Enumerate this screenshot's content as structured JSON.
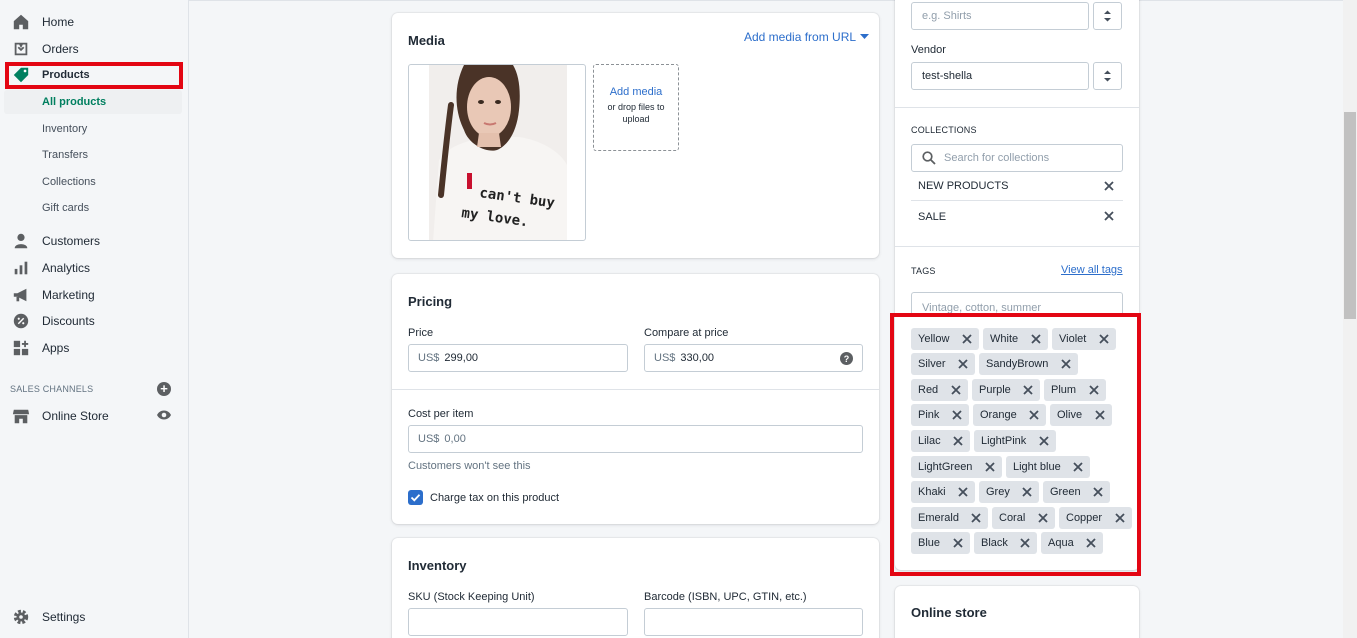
{
  "sidebar": {
    "items": [
      {
        "label": "Home",
        "icon": "home-icon"
      },
      {
        "label": "Orders",
        "icon": "orders-icon"
      },
      {
        "label": "Products",
        "icon": "tag-icon"
      },
      {
        "label": "Customers",
        "icon": "person-icon"
      },
      {
        "label": "Analytics",
        "icon": "bar-chart-icon"
      },
      {
        "label": "Marketing",
        "icon": "megaphone-icon"
      },
      {
        "label": "Discounts",
        "icon": "discount-icon"
      },
      {
        "label": "Apps",
        "icon": "apps-icon"
      }
    ],
    "product_sub": [
      "All products",
      "Inventory",
      "Transfers",
      "Collections",
      "Gift cards"
    ],
    "sales_channels_label": "SALES CHANNELS",
    "online_store": "Online Store",
    "settings": "Settings",
    "active_color": "#008060",
    "highlight_color": "#e30613"
  },
  "media": {
    "title": "Media",
    "add_from_url": "Add media from URL",
    "image_text_line1": "can't buy",
    "image_text_line2": "my love.",
    "add_media": "Add media",
    "drop_files": "or drop files to upload"
  },
  "pricing": {
    "title": "Pricing",
    "price_label": "Price",
    "price_prefix": "US$",
    "price_value": "299,00",
    "compare_label": "Compare at price",
    "compare_prefix": "US$",
    "compare_value": "330,00",
    "cost_label": "Cost per item",
    "cost_prefix": "US$",
    "cost_value": "0,00",
    "cost_help": "Customers won't see this",
    "charge_tax": "Charge tax on this product"
  },
  "inventory": {
    "title": "Inventory",
    "sku_label": "SKU (Stock Keeping Unit)",
    "barcode_label": "Barcode (ISBN, UPC, GTIN, etc.)"
  },
  "organization": {
    "type_placeholder": "e.g. Shirts",
    "vendor_label": "Vendor",
    "vendor_value": "test-shella",
    "collections_label": "COLLECTIONS",
    "collections_search": "Search for collections",
    "collections": [
      "NEW PRODUCTS",
      "SALE"
    ],
    "tags_label": "TAGS",
    "view_all_tags": "View all tags",
    "tags_placeholder": "Vintage, cotton, summer",
    "tags": [
      "Yellow",
      "White",
      "Violet",
      "Silver",
      "SandyBrown",
      "Red",
      "Purple",
      "Plum",
      "Pink",
      "Orange",
      "Olive",
      "Lilac",
      "LightPink",
      "LightGreen",
      "Light blue",
      "Khaki",
      "Grey",
      "Green",
      "Emerald",
      "Coral",
      "Copper",
      "Blue",
      "Black",
      "Aqua"
    ]
  },
  "online_store_card": {
    "title": "Online store"
  }
}
